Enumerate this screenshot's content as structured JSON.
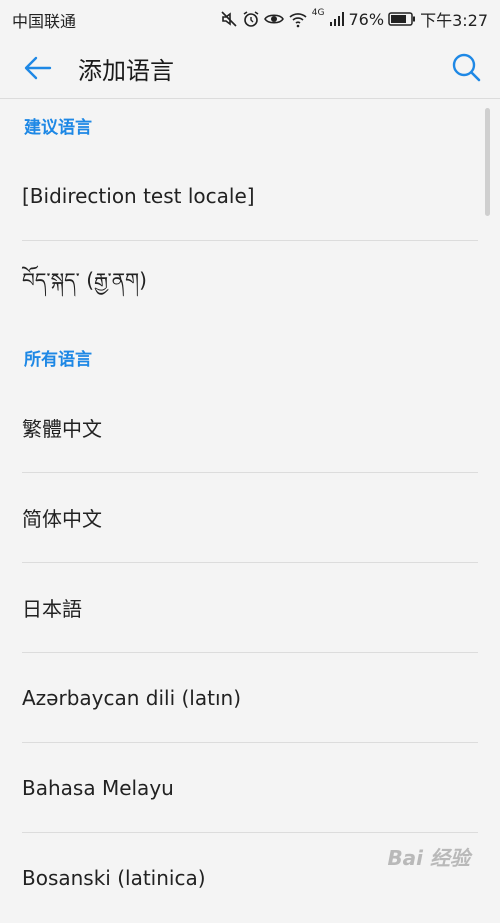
{
  "status_bar": {
    "carrier": "中国联通",
    "network": "4G",
    "battery": "76%",
    "time": "下午3:27",
    "icons": [
      "mute-icon",
      "alarm-icon",
      "eye-icon",
      "wifi-icon",
      "signal-icon",
      "battery-icon"
    ]
  },
  "app_bar": {
    "title": "添加语言",
    "back_icon": "arrow-left-icon",
    "search_icon": "search-icon"
  },
  "sections": [
    {
      "header": "建议语言",
      "items": [
        "[Bidirection test locale]",
        "བོད་སྐད་ (རྒྱ་ནག)"
      ]
    },
    {
      "header": "所有语言",
      "items": [
        "繁體中文",
        "简体中文",
        "日本語",
        "Azərbaycan dili (latın)",
        "Bahasa Melayu",
        "Bosanski (latinica)"
      ]
    }
  ],
  "watermark": "Bai 经验",
  "colors": {
    "accent": "#1e88e5",
    "background": "#f4f4f4",
    "divider": "#dcdcdc"
  }
}
